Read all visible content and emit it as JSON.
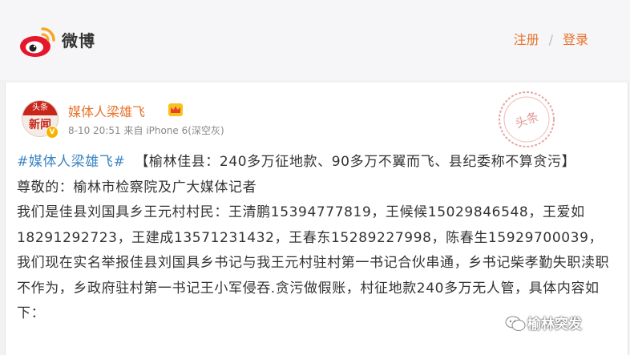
{
  "header": {
    "logo_text": "微博",
    "register_label": "注册",
    "separator": "/",
    "login_label": "登录"
  },
  "post": {
    "author": "媒体人梁雄飞",
    "avatar_top": "头条",
    "avatar_bottom": "新闻",
    "timestamp": "8-10 20:51",
    "source_prefix": "来自",
    "source_device": "iPhone 6(深空灰)",
    "stamp_text": "头条",
    "hashtag": "#媒体人梁雄飞#",
    "title": "【榆林佳县：240多万征地款、90多万不翼而飞、县纪委称不算贪污】",
    "greeting": "尊敬的：榆林市检察院及广大媒体记者",
    "body": "我们是佳县刘国具乡王元村村民：王清鹏15394777819，王候候15029846548，王爱如18291292723，王建成13571231432，王春东15289227998，陈春生15929700039，我们现在实名举报佳县刘国具乡书记与我王元村驻村第一书记合伙串通，乡书记柴孝勤失职渎职不作为，乡政府驻村第一书记王小军侵吞.贪污做假账，村征地款240多万无人管，具体内容如下："
  },
  "watermark": {
    "text": "榆林突发"
  },
  "colors": {
    "accent_orange": "#e8722a",
    "hashtag_blue": "#3b86c4",
    "weibo_red": "#e6162d"
  }
}
